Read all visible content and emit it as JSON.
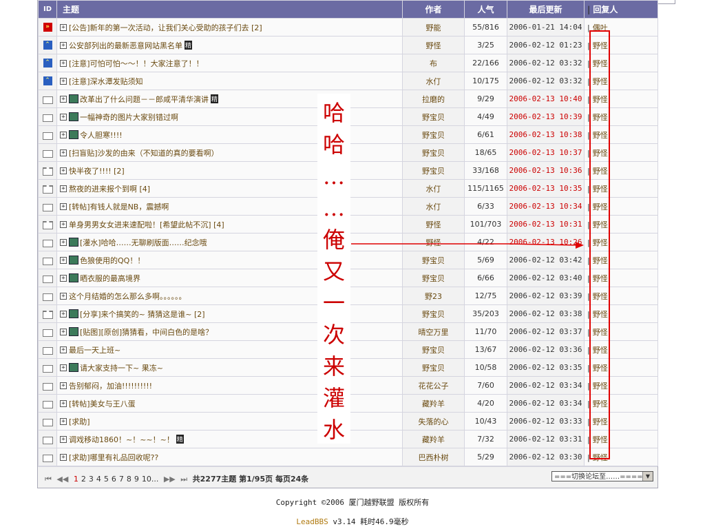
{
  "header": {
    "id": "ID",
    "title": "主题",
    "author": "作者",
    "popularity": "人气",
    "last_update": "最后更新",
    "reply": "回复人"
  },
  "rows": [
    {
      "icon": "hot",
      "title": "[公告]新年的第一次活动，让我们关心受助的孩子们去 [2]",
      "pic": false,
      "jing": false,
      "author": "野能",
      "pop": "55/816",
      "time": "2006-01-21 14:04",
      "time_red": false,
      "reply": "偶叶"
    },
    {
      "icon": "up",
      "title": "公安部列出的最新恶意网站黑名单",
      "pic": false,
      "jing": true,
      "author": "野怪",
      "pop": "3/25",
      "time": "2006-02-12 01:23",
      "time_red": false,
      "reply": "野怪"
    },
    {
      "icon": "up",
      "title": "[注意]可怕可怕～～！！大家注意了！！",
      "pic": false,
      "jing": false,
      "author": "布",
      "pop": "22/166",
      "time": "2006-02-12 03:32",
      "time_red": false,
      "reply": "野怪"
    },
    {
      "icon": "up",
      "title": "[注意]深水潭发贴须知",
      "pic": false,
      "jing": false,
      "author": "水仃",
      "pop": "10/175",
      "time": "2006-02-12 03:32",
      "time_red": false,
      "reply": "野怪"
    },
    {
      "icon": "folder",
      "title": "改革出了什么问题－－郎咸平清华演讲",
      "pic": true,
      "jing": true,
      "author": "拉磨的",
      "pop": "9/29",
      "time": "2006-02-13 10:40",
      "time_red": true,
      "reply": "野怪"
    },
    {
      "icon": "folder",
      "title": "一幅神奇的图片大家别错过啊",
      "pic": true,
      "jing": false,
      "author": "野宝贝",
      "pop": "4/49",
      "time": "2006-02-13 10:39",
      "time_red": true,
      "reply": "野怪"
    },
    {
      "icon": "folder",
      "title": "令人胆寒!!!!",
      "pic": true,
      "jing": false,
      "author": "野宝贝",
      "pop": "6/61",
      "time": "2006-02-13 10:38",
      "time_red": true,
      "reply": "野怪"
    },
    {
      "icon": "folder",
      "title": "[扫盲贴]沙发的由来（不知道的真的要看啊）",
      "pic": false,
      "jing": false,
      "author": "野宝贝",
      "pop": "18/65",
      "time": "2006-02-13 10:37",
      "time_red": true,
      "reply": "野怪"
    },
    {
      "icon": "folder-hot",
      "title": "快半夜了!!!! [2]",
      "pic": false,
      "jing": false,
      "author": "野宝贝",
      "pop": "33/168",
      "time": "2006-02-13 10:36",
      "time_red": true,
      "reply": "野怪"
    },
    {
      "icon": "folder-hot",
      "title": "熬夜的进来报个到啊 [4]",
      "pic": false,
      "jing": false,
      "author": "水仃",
      "pop": "115/1165",
      "time": "2006-02-13 10:35",
      "time_red": true,
      "reply": "野怪"
    },
    {
      "icon": "folder",
      "title": "[转帖]有钱人就是NB，震撼啊",
      "pic": false,
      "jing": false,
      "author": "水仃",
      "pop": "6/33",
      "time": "2006-02-13 10:34",
      "time_red": true,
      "reply": "野怪"
    },
    {
      "icon": "folder-hot",
      "title": "单身男男女女进来速配啦！[希望此帖不沉] [4]",
      "pic": false,
      "jing": false,
      "author": "野怪",
      "pop": "101/703",
      "time": "2006-02-13 10:31",
      "time_red": true,
      "reply": "野怪"
    },
    {
      "icon": "folder",
      "title": "[灌水]哈哈……无聊刷版面……纪念哦",
      "pic": true,
      "jing": false,
      "author": "野怪",
      "pop": "4/22",
      "time": "2006-02-13 10:26",
      "time_red": true,
      "reply": "野怪"
    },
    {
      "icon": "folder",
      "title": "色狼使用的QQ！！",
      "pic": true,
      "jing": false,
      "author": "野宝贝",
      "pop": "5/69",
      "time": "2006-02-12 03:42",
      "time_red": false,
      "reply": "野怪"
    },
    {
      "icon": "folder",
      "title": "晒衣服的最高境界",
      "pic": true,
      "jing": false,
      "author": "野宝贝",
      "pop": "6/66",
      "time": "2006-02-12 03:40",
      "time_red": false,
      "reply": "野怪"
    },
    {
      "icon": "folder",
      "title": "这个月结婚的怎么那么多啊。。。。。。",
      "pic": false,
      "jing": false,
      "author": "野23",
      "pop": "12/75",
      "time": "2006-02-12 03:39",
      "time_red": false,
      "reply": "野怪"
    },
    {
      "icon": "folder-hot",
      "title": "[分享]来个搞笑的~ 猜猜这是谁~ [2]",
      "pic": true,
      "jing": false,
      "author": "野宝贝",
      "pop": "35/203",
      "time": "2006-02-12 03:38",
      "time_red": false,
      "reply": "野怪"
    },
    {
      "icon": "folder",
      "title": "[贴图][原创]猜猜看，中间白色的是啥？",
      "pic": true,
      "jing": false,
      "author": "晴空万里",
      "pop": "11/70",
      "time": "2006-02-12 03:37",
      "time_red": false,
      "reply": "野怪"
    },
    {
      "icon": "folder",
      "title": "最后一天上班~",
      "pic": false,
      "jing": false,
      "author": "野宝贝",
      "pop": "13/67",
      "time": "2006-02-12 03:36",
      "time_red": false,
      "reply": "野怪"
    },
    {
      "icon": "folder",
      "title": "请大家支持一下~ 果冻~",
      "pic": true,
      "jing": false,
      "author": "野宝贝",
      "pop": "10/58",
      "time": "2006-02-12 03:35",
      "time_red": false,
      "reply": "野怪"
    },
    {
      "icon": "folder",
      "title": "告别郁闷，加油!!!!!!!!!!",
      "pic": false,
      "jing": false,
      "author": "花花公子",
      "pop": "7/60",
      "time": "2006-02-12 03:34",
      "time_red": false,
      "reply": "野怪"
    },
    {
      "icon": "folder",
      "title": "[转帖]美女与王八蛋",
      "pic": false,
      "jing": false,
      "author": "藏羚羊",
      "pop": "4/20",
      "time": "2006-02-12 03:34",
      "time_red": false,
      "reply": "野怪"
    },
    {
      "icon": "folder",
      "title": "[求助]",
      "pic": false,
      "jing": false,
      "author": "失落的心",
      "pop": "10/43",
      "time": "2006-02-12 03:33",
      "time_red": false,
      "reply": "野怪"
    },
    {
      "icon": "folder",
      "title": "调戏移动1860！~！~~！~！",
      "pic": false,
      "jing": true,
      "author": "藏羚羊",
      "pop": "7/32",
      "time": "2006-02-12 03:31",
      "time_red": false,
      "reply": "野怪"
    },
    {
      "icon": "folder",
      "title": "[求助]哪里有礼品回收呢??",
      "pic": false,
      "jing": false,
      "author": "巴西朴树",
      "pop": "5/29",
      "time": "2006-02-12 03:30",
      "time_red": false,
      "reply": "野怪"
    }
  ],
  "labels": {
    "jing": "精",
    "plus": "+",
    "bar": "|"
  },
  "pager": {
    "first": "⏮",
    "prev": "◀◀",
    "pages": [
      "1",
      "2",
      "3",
      "4",
      "5",
      "6",
      "7",
      "8",
      "9",
      "10..."
    ],
    "current": "1",
    "next": "▶▶",
    "last": "⏭",
    "summary_pre": "共",
    "total_topics": "2277",
    "summary_mid1": "主题 第",
    "page_pos": "1/95",
    "summary_mid2": "页 每页",
    "per_page": "24",
    "summary_post": "条"
  },
  "jump": {
    "label": "===切换论坛至……====",
    "arrow": "▼"
  },
  "copyright": "Copyright ©2006 厦门越野联盟 版权所有",
  "powered": {
    "brand": "LeadBBS",
    "text": " v3.14 耗时46.9毫秒"
  },
  "annotation": {
    "chars": [
      "哈",
      "哈",
      "…",
      "…",
      "俺",
      "又",
      "一",
      "次",
      "来",
      "灌",
      "水"
    ]
  },
  "colors": {
    "header_bg": "#6b6ba3",
    "highlight": "#e00000",
    "time_new": "#cc0000",
    "link": "#6a4a10"
  }
}
